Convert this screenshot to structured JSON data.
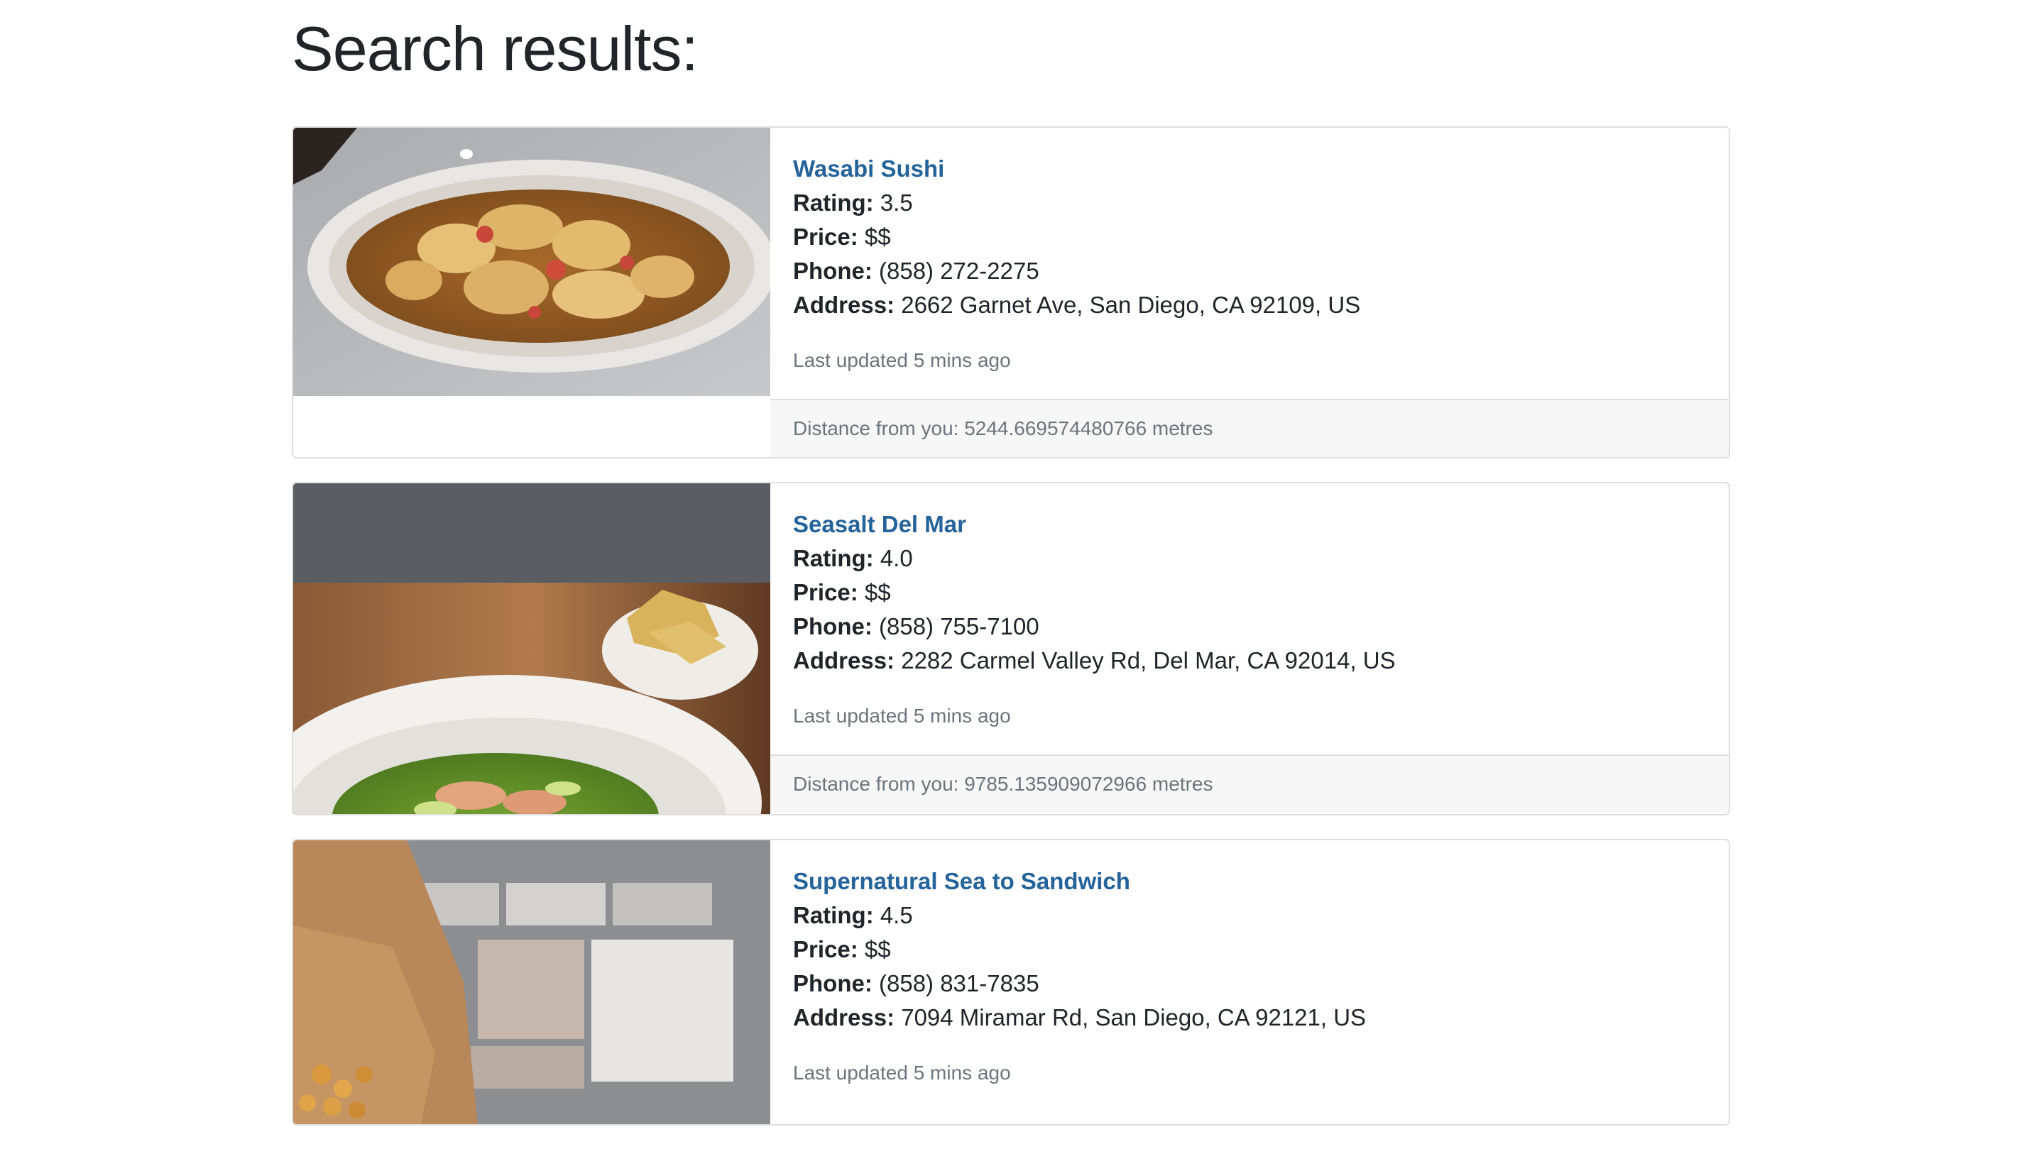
{
  "page": {
    "title": "Search results:"
  },
  "labels": {
    "rating": "Rating:",
    "price": "Price:",
    "phone": "Phone:",
    "address": "Address:"
  },
  "results": [
    {
      "name": "Wasabi Sushi",
      "rating": "3.5",
      "price": "$$",
      "phone": "(858) 272-2275",
      "address": "2662 Garnet Ave, San Diego, CA 92109, US",
      "updated": "Last updated 5 mins ago",
      "distance": "Distance from you: 5244.669574480766 metres"
    },
    {
      "name": "Seasalt Del Mar",
      "rating": "4.0",
      "price": "$$",
      "phone": "(858) 755-7100",
      "address": "2282 Carmel Valley Rd, Del Mar, CA 92014, US",
      "updated": "Last updated 5 mins ago",
      "distance": "Distance from you: 9785.135909072966 metres"
    },
    {
      "name": "Supernatural Sea to Sandwich",
      "rating": "4.5",
      "price": "$$",
      "phone": "(858) 831-7835",
      "address": "7094 Miramar Rd, San Diego, CA 92121, US",
      "updated": "Last updated 5 mins ago"
    }
  ],
  "colors": {
    "link": "#25639b",
    "muted": "#6c757d",
    "footer_bg": "#f7f7f7",
    "border": "#dfdfdf"
  }
}
